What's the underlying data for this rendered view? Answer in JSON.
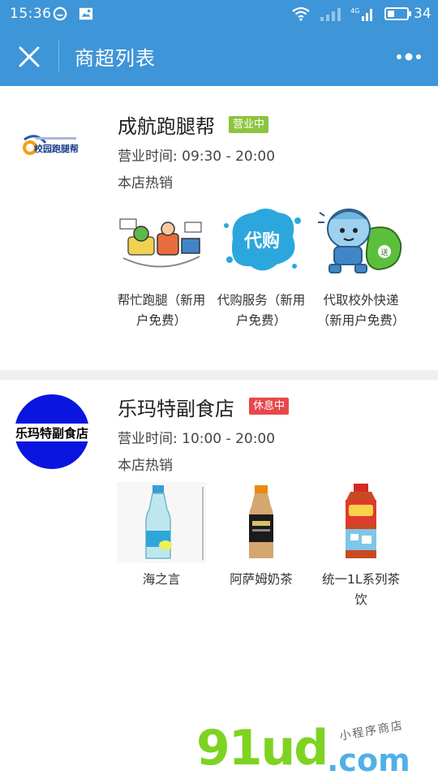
{
  "status_bar": {
    "time": "15:36",
    "battery": "34",
    "network": "4G"
  },
  "header": {
    "title": "商超列表",
    "close_icon": "close-icon",
    "more_icon": "more-dots-icon"
  },
  "stores": [
    {
      "name": "成航跑腿帮",
      "status": "营业中",
      "status_color": "#8cc540",
      "hours": "营业时间: 09:30 - 20:00",
      "hot_label": "本店热销",
      "logo_text": "校园跑腿帮",
      "products": [
        {
          "name": "帮忙跑腿（新用户免费）"
        },
        {
          "name": "代购服务（新用户免费）",
          "image_text": "代购"
        },
        {
          "name": "代取校外快递（新用户免费）",
          "image_text": "送"
        }
      ]
    },
    {
      "name": "乐玛特副食店",
      "status": "休息中",
      "status_color": "#e8474c",
      "hours": "营业时间: 10:00 - 20:00",
      "hot_label": "本店热销",
      "logo_text": "乐玛特副食店",
      "products": [
        {
          "name": "海之言"
        },
        {
          "name": "阿萨姆奶茶"
        },
        {
          "name": "统一1L系列茶饮"
        }
      ]
    }
  ],
  "watermark": {
    "main": "91ud",
    "suffix": ".com",
    "tagline": "小程序商店"
  }
}
